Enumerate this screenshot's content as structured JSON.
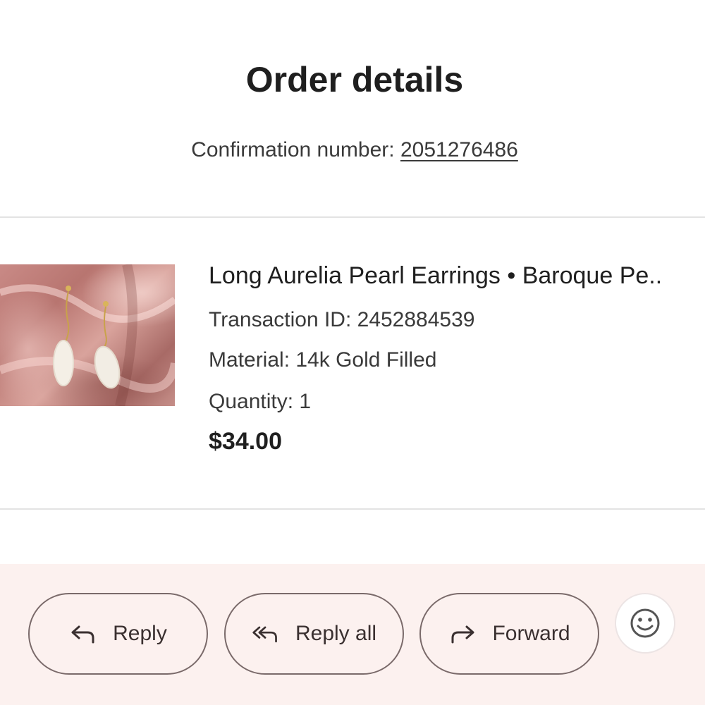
{
  "header": {
    "title": "Order details",
    "confirmation_label": "Confirmation number:",
    "confirmation_number": "2051276486"
  },
  "item": {
    "name": "Long Aurelia Pearl Earrings • Baroque Pe..",
    "transaction_id": "Transaction ID: 2452884539",
    "material": "Material: 14k Gold Filled",
    "quantity": "Quantity: 1",
    "price": "$34.00",
    "image_icon": "product-photo"
  },
  "actions": {
    "reply_label": "Reply",
    "reply_all_label": "Reply all",
    "forward_label": "Forward",
    "reply_icon": "reply-icon",
    "reply_all_icon": "reply-all-icon",
    "forward_icon": "forward-icon",
    "emoji_icon": "smiley-icon"
  },
  "colors": {
    "action_bar_bg": "#fcf1ef",
    "pill_border": "#7a6a6a",
    "text_primary": "#1f1f1f",
    "text_secondary": "#3a3a3a"
  }
}
